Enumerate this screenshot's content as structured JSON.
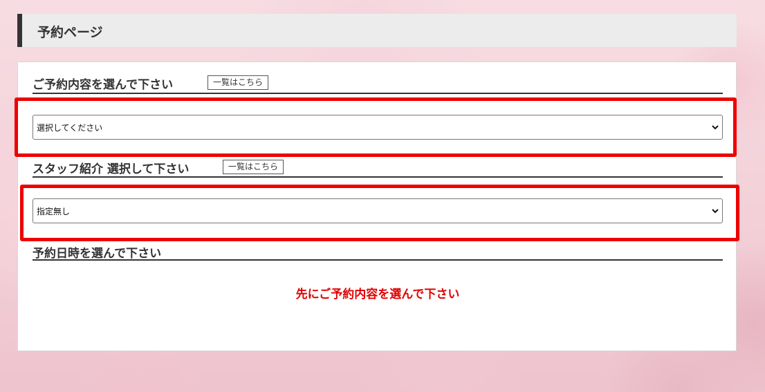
{
  "page_title": "予約ページ",
  "sections": {
    "service": {
      "heading": "ご予約内容を選んで下さい",
      "list_button": "一覧はこちら",
      "select_value": "選択してください"
    },
    "staff": {
      "heading": "スタッフ紹介 選択して下さい",
      "list_button": "一覧はこちら",
      "select_value": "指定無し"
    },
    "datetime": {
      "heading": "予約日時を選んで下さい",
      "notice": "先にご予約内容を選んで下さい"
    }
  },
  "colors": {
    "highlight": "#ee0000",
    "notice": "#e10000",
    "header_bar": "#333333"
  },
  "icons": {
    "select_arrow": "chevron-down-icon"
  }
}
